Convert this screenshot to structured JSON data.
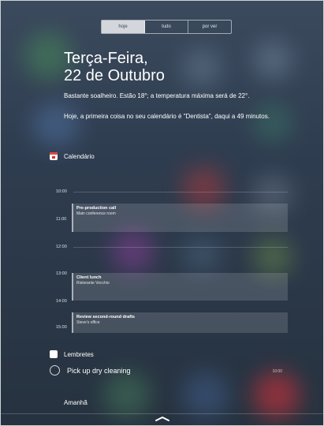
{
  "tabs": [
    "hoje",
    "tudo",
    "por ver"
  ],
  "active_tab": 0,
  "date": {
    "weekday": "Terça-Feira,",
    "day": "22 de Outubro"
  },
  "weather": "Bastante soalheiro. Estão 18°; a temperatura máxima será de 22°.",
  "calendar_summary": "Hoje, a primeira coisa no seu calendário é \"Dentista\", daqui a 49 minutos.",
  "calendar": {
    "title": "Calendário",
    "hours": [
      "10:00",
      "11:00",
      "12:00",
      "13:00",
      "14:00",
      "15:00"
    ],
    "events": [
      {
        "title": "Pre-production call",
        "location": "Main conference room"
      },
      {
        "title": "Client lunch",
        "location": "Ristorante Vecchio"
      },
      {
        "title": "Review second-round drafts",
        "location": "Steve's office"
      }
    ]
  },
  "reminders": {
    "title": "Lembretes",
    "items": [
      {
        "text": "Pick up dry cleaning",
        "time": "10:00"
      }
    ]
  },
  "tomorrow_label": "Amanhã",
  "colors": {
    "accent_red": "#e2473d",
    "active_tab_bg": "#c7cbd1"
  },
  "icons": [
    "calendar-icon",
    "reminders-icon",
    "chevron-up-icon"
  ]
}
